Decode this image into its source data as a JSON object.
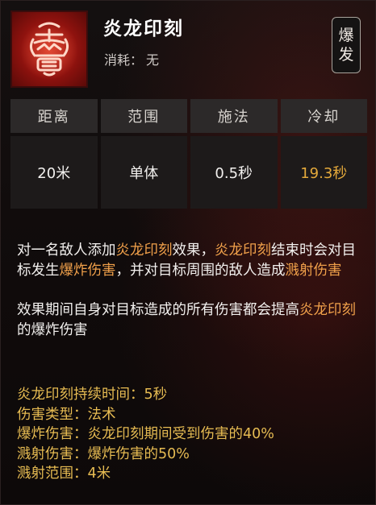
{
  "skill": {
    "name": "炎龙印刻",
    "cost_label": "消耗：",
    "cost_value": "无",
    "tag_chars": [
      "爆",
      "发"
    ]
  },
  "stats": [
    {
      "label": "距离",
      "value": "20米",
      "highlight": false
    },
    {
      "label": "范围",
      "value": "单体",
      "highlight": false
    },
    {
      "label": "施法",
      "value": "0.5秒",
      "highlight": false
    },
    {
      "label": "冷却",
      "value": "19.3秒",
      "highlight": true
    }
  ],
  "description": {
    "para1": {
      "t1": "对一名敌人添加",
      "h1": "炎龙印刻",
      "t2": "效果，",
      "h2": "炎龙印刻",
      "t3": "结束时会对目标发生",
      "h3": "爆炸伤害",
      "t4": "，并对目标周围的敌人造成",
      "h4": "溅射伤害"
    },
    "para2": {
      "t1": "效果期间自身对目标造成的所有伤害都会提高",
      "h1": "炎龙印刻",
      "t2": "的爆炸伤害"
    }
  },
  "properties": [
    {
      "label": "炎龙印刻持续时间：",
      "value": "5秒"
    },
    {
      "label": "伤害类型：",
      "value": "法术"
    },
    {
      "label": "爆炸伤害：",
      "value": "炎龙印刻期间受到伤害的40%"
    },
    {
      "label": "溅射伤害：",
      "value": "爆炸伤害的50%"
    },
    {
      "label": "溅射范围：",
      "value": "4米"
    }
  ],
  "colors": {
    "highlight": "#f0a04a",
    "property_gold": "#e6bb52",
    "cooldown_gold": "#e4a93b",
    "icon_red": "#c5281d"
  },
  "icons": {
    "skill_icon": "fire-dragon-seal-icon"
  }
}
